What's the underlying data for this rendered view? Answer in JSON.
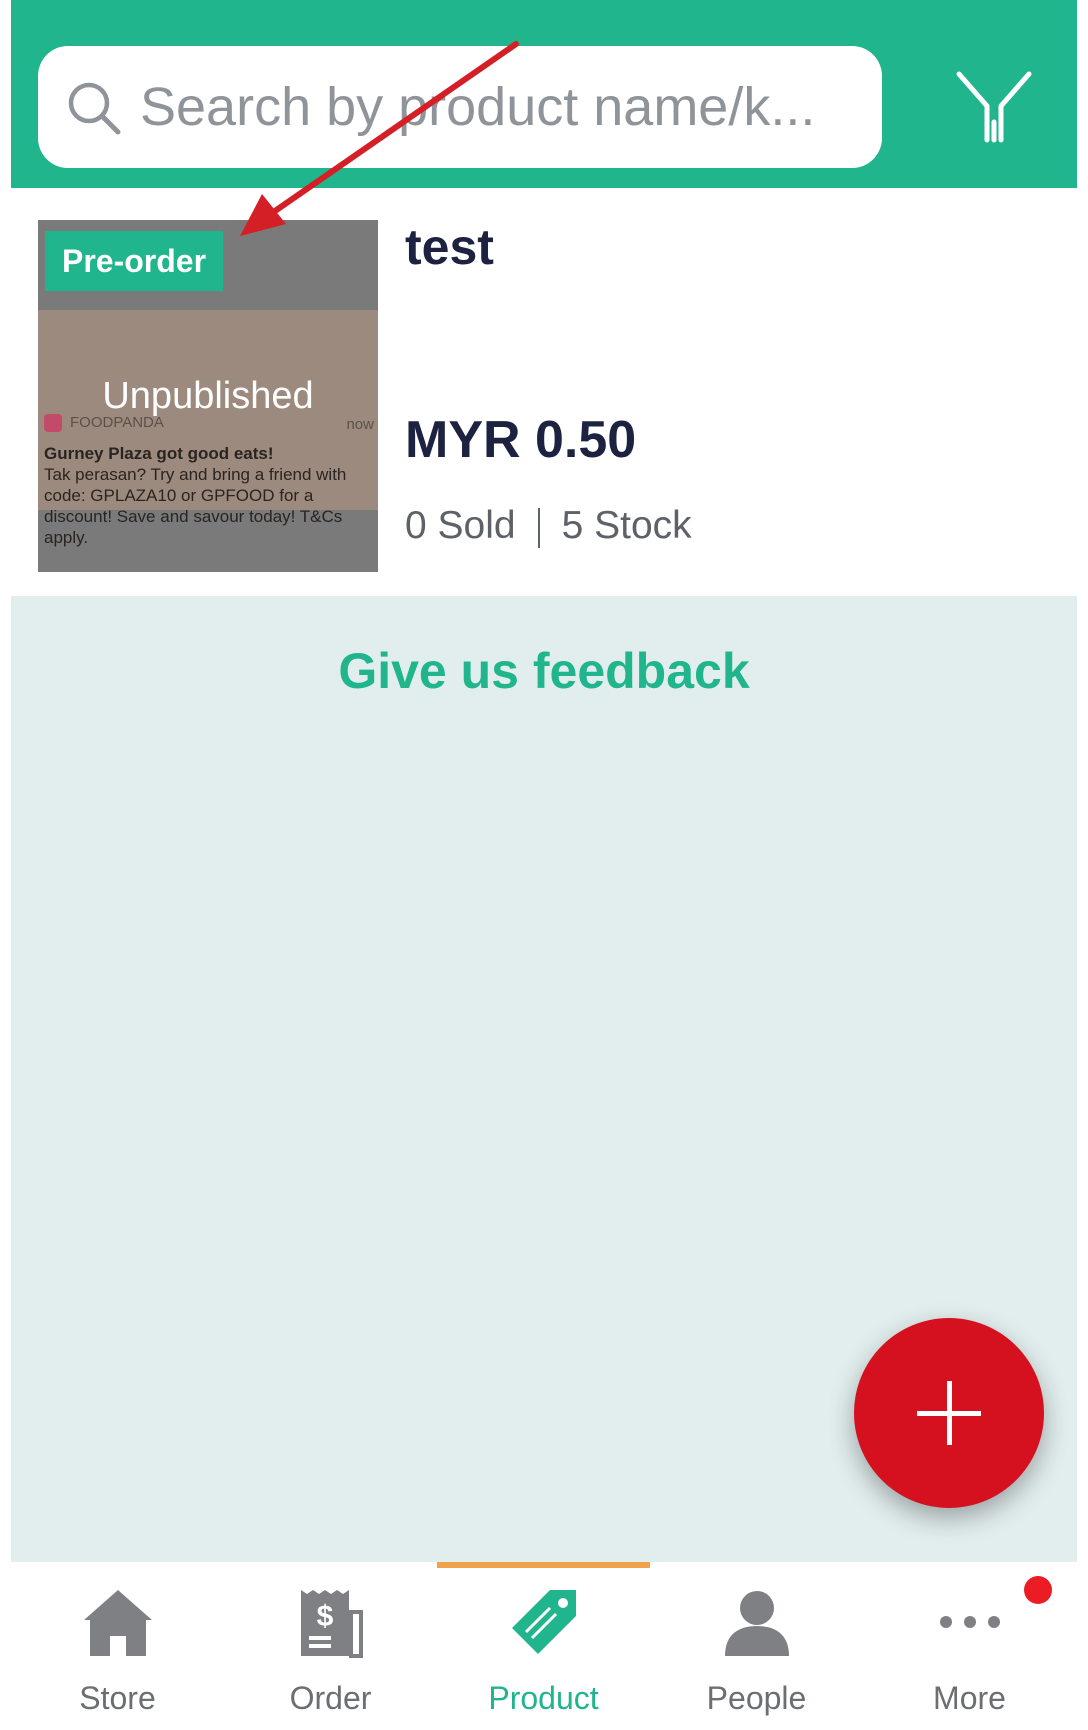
{
  "search": {
    "placeholder": "Search by product name/k..."
  },
  "product": {
    "badge": "Pre-order",
    "status": "Unpublished",
    "title": "test",
    "price": "MYR 0.50",
    "sold": "0 Sold",
    "stock": "5 Stock",
    "thumbnail_text": {
      "app": "FOODPANDA",
      "time": "now",
      "lines": [
        "Gurney Plaza got good eats!",
        "Tak perasan? Try and bring a friend with",
        "code: GPLAZA10 or GPFOOD for a",
        "discount! Save and savour today! T&Cs",
        "apply."
      ]
    }
  },
  "feedback": {
    "label": "Give us feedback"
  },
  "fab": {
    "icon": "plus-icon"
  },
  "nav": {
    "items": [
      {
        "label": "Store",
        "icon": "store-icon"
      },
      {
        "label": "Order",
        "icon": "order-receipt-icon"
      },
      {
        "label": "Product",
        "icon": "product-tag-icon",
        "active": true
      },
      {
        "label": "People",
        "icon": "people-icon"
      },
      {
        "label": "More",
        "icon": "more-dots-icon",
        "notification": true
      }
    ]
  },
  "colors": {
    "primary": "#21b58d",
    "title_text": "#1c2240",
    "fab": "#d6111f",
    "active_indicator": "#f0a24b",
    "background": "#e2eeee",
    "notification_dot": "#ec1c24"
  }
}
